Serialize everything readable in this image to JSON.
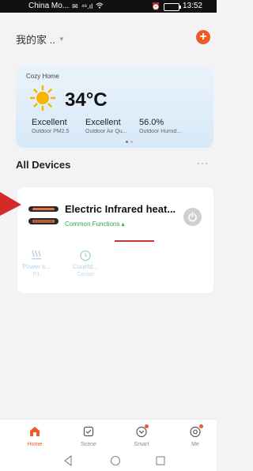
{
  "status_bar": {
    "carrier": "China Mo...",
    "signal_text": "⁴⁶.ıl",
    "time": "13:52"
  },
  "header": {
    "home_name": "我的家 .."
  },
  "weather": {
    "location": "Cozy Home",
    "temperature": "34°C",
    "stats": [
      {
        "value": "Excellent",
        "label": "Outdoor PM2.5"
      },
      {
        "value": "Excellent",
        "label": "Outdoor Air Qu..."
      },
      {
        "value": "56.0%",
        "label": "Outdoor Humid..."
      }
    ]
  },
  "devices_section": {
    "title": "All Devices",
    "more": "···"
  },
  "device": {
    "name": "Electric Infrared heat...",
    "functions_label": "Common Functions ▴",
    "functions": [
      {
        "icon": "heat-waves-icon",
        "label": "Power s...",
        "sub": "P1"
      },
      {
        "icon": "timer-icon",
        "label": "Countd...",
        "sub": "Cancel"
      }
    ]
  },
  "tabs": [
    {
      "label": "Home",
      "icon": "home-icon",
      "active": true
    },
    {
      "label": "Scene",
      "icon": "scene-icon",
      "active": false
    },
    {
      "label": "Smart",
      "icon": "smart-icon",
      "active": false
    },
    {
      "label": "Me",
      "icon": "me-icon",
      "active": false
    }
  ],
  "colors": {
    "accent": "#f05a24",
    "green": "#2aa84a",
    "annotation_red": "#c83333"
  }
}
